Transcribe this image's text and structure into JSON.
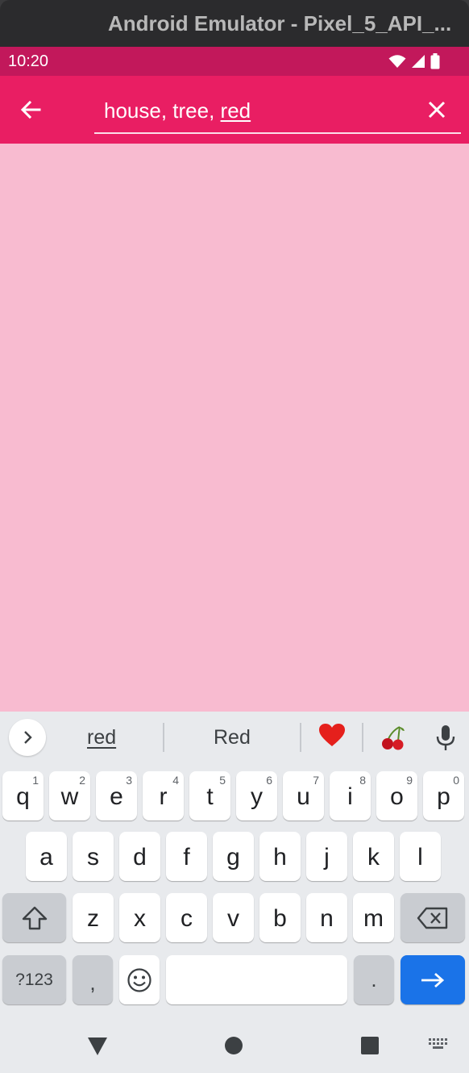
{
  "window": {
    "title": "Android Emulator - Pixel_5_API_..."
  },
  "status": {
    "time": "10:20"
  },
  "search": {
    "committed": "house, tree, ",
    "composing": "red"
  },
  "suggestions": {
    "left": "red",
    "center": "Red",
    "emoji1": "❤️",
    "emoji2": "🍒"
  },
  "keyboard": {
    "row1": [
      {
        "k": "q",
        "n": "1"
      },
      {
        "k": "w",
        "n": "2"
      },
      {
        "k": "e",
        "n": "3"
      },
      {
        "k": "r",
        "n": "4"
      },
      {
        "k": "t",
        "n": "5"
      },
      {
        "k": "y",
        "n": "6"
      },
      {
        "k": "u",
        "n": "7"
      },
      {
        "k": "i",
        "n": "8"
      },
      {
        "k": "o",
        "n": "9"
      },
      {
        "k": "p",
        "n": "0"
      }
    ],
    "row2": [
      "a",
      "s",
      "d",
      "f",
      "g",
      "h",
      "j",
      "k",
      "l"
    ],
    "row3": [
      "z",
      "x",
      "c",
      "v",
      "b",
      "n",
      "m"
    ],
    "symbols_label": "?123",
    "comma": ",",
    "period": "."
  },
  "icons": {
    "back": "arrow-back-icon",
    "clear": "close-icon",
    "expand": "chevron-right-icon",
    "mic": "microphone-icon",
    "shift": "shift-icon",
    "backspace": "backspace-icon",
    "emoji": "emoji-icon",
    "enter": "arrow-right-icon"
  },
  "colors": {
    "status_bar": "#c2185b",
    "app_bar": "#e91e63",
    "content_bg": "#f8bbd0",
    "action_key": "#1a73e8"
  }
}
